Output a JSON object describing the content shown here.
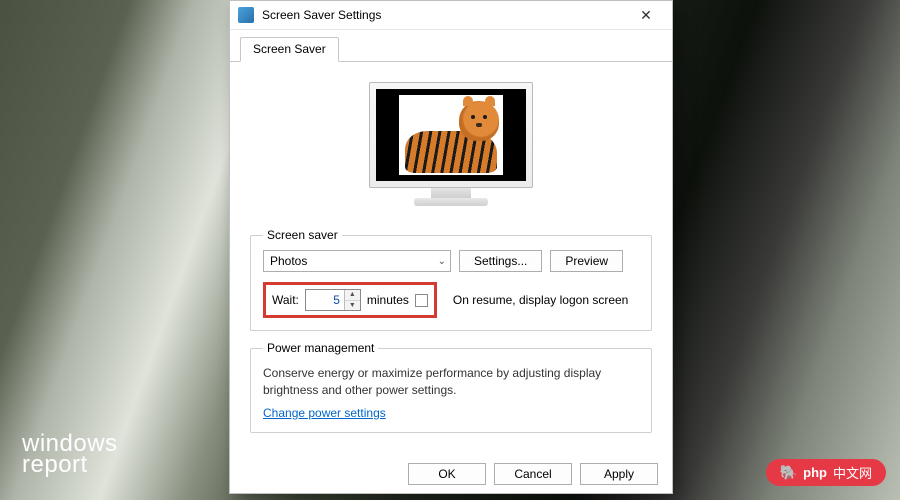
{
  "watermarks": {
    "left_line1": "windows",
    "left_line2": "report",
    "right_text": "中文网",
    "right_prefix": "php"
  },
  "dialog": {
    "title": "Screen Saver Settings",
    "tab_label": "Screen Saver",
    "screensaver_group": {
      "legend": "Screen saver",
      "selected": "Photos",
      "settings_btn": "Settings...",
      "preview_btn": "Preview",
      "wait_label": "Wait:",
      "wait_value": "5",
      "minutes_label": "minutes",
      "resume_label": "On resume, display logon screen"
    },
    "power_group": {
      "legend": "Power management",
      "description": "Conserve energy or maximize performance by adjusting display brightness and other power settings.",
      "link": "Change power settings"
    },
    "buttons": {
      "ok": "OK",
      "cancel": "Cancel",
      "apply": "Apply"
    }
  }
}
